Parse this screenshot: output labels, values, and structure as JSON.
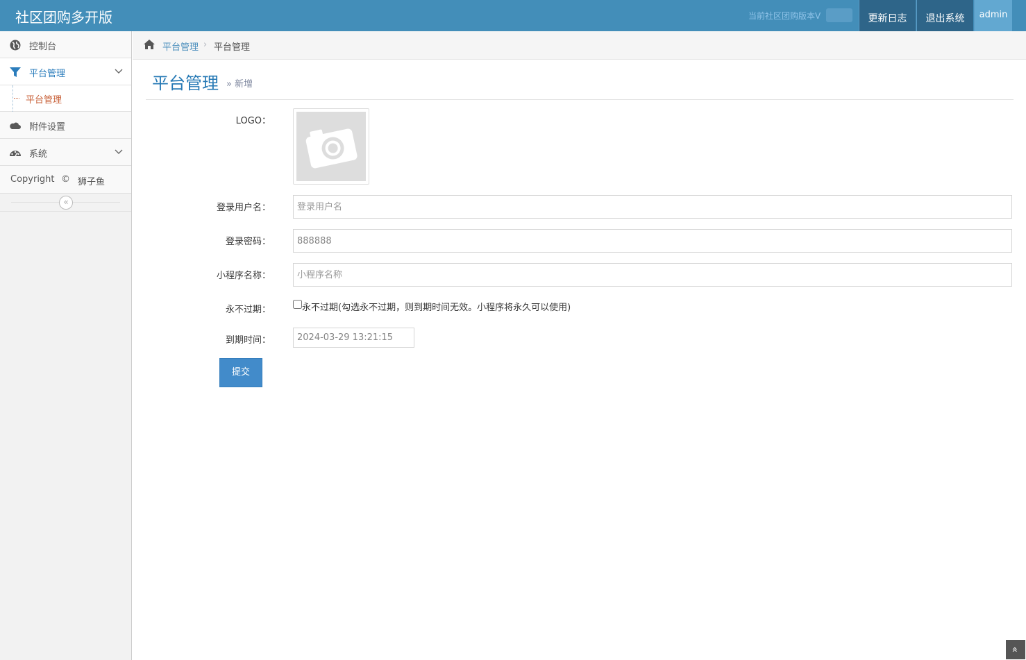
{
  "navbar": {
    "brand": "社区团购多开版",
    "version_text": "当前社区团购版本V",
    "changelog_label": "更新日志",
    "logout_label": "退出系统",
    "user_label": "admin"
  },
  "sidebar": {
    "items": [
      {
        "label": "控制台",
        "icon": "globe-icon"
      },
      {
        "label": "平台管理",
        "icon": "filter-icon"
      },
      {
        "label": "附件设置",
        "icon": "cloud-icon"
      },
      {
        "label": "系统",
        "icon": "dashboard-icon"
      }
    ],
    "sub_item": "平台管理",
    "copyright": {
      "text": "Copyright",
      "symbol": "©",
      "author": "狮子鱼"
    },
    "collapse_icon": "«"
  },
  "breadcrumb": {
    "link": "平台管理",
    "separator": "›",
    "current": "平台管理"
  },
  "page": {
    "title": "平台管理",
    "subtitle": "» 新增"
  },
  "form": {
    "logo_label": "LOGO：",
    "username_label": "登录用户名：",
    "username_placeholder": "登录用户名",
    "password_label": "登录密码：",
    "password_value": "888888",
    "appname_label": "小程序名称：",
    "appname_placeholder": "小程序名称",
    "never_expire_label": "永不过期：",
    "never_expire_text": "永不过期(勾选永不过期，则到期时间无效。小程序将永久可以使用)",
    "never_expire_checked": false,
    "expire_label": "到期时间：",
    "expire_value": "2024-03-29 13:21:15",
    "submit_label": "提交"
  },
  "scroll_top_icon": "»",
  "colors": {
    "navbar": "#438eb9",
    "nav_button": "#2e6589",
    "user_button": "#62a8d1",
    "accent": "#2679b5",
    "submenu_active": "#c86139",
    "submit": "#428bca"
  }
}
